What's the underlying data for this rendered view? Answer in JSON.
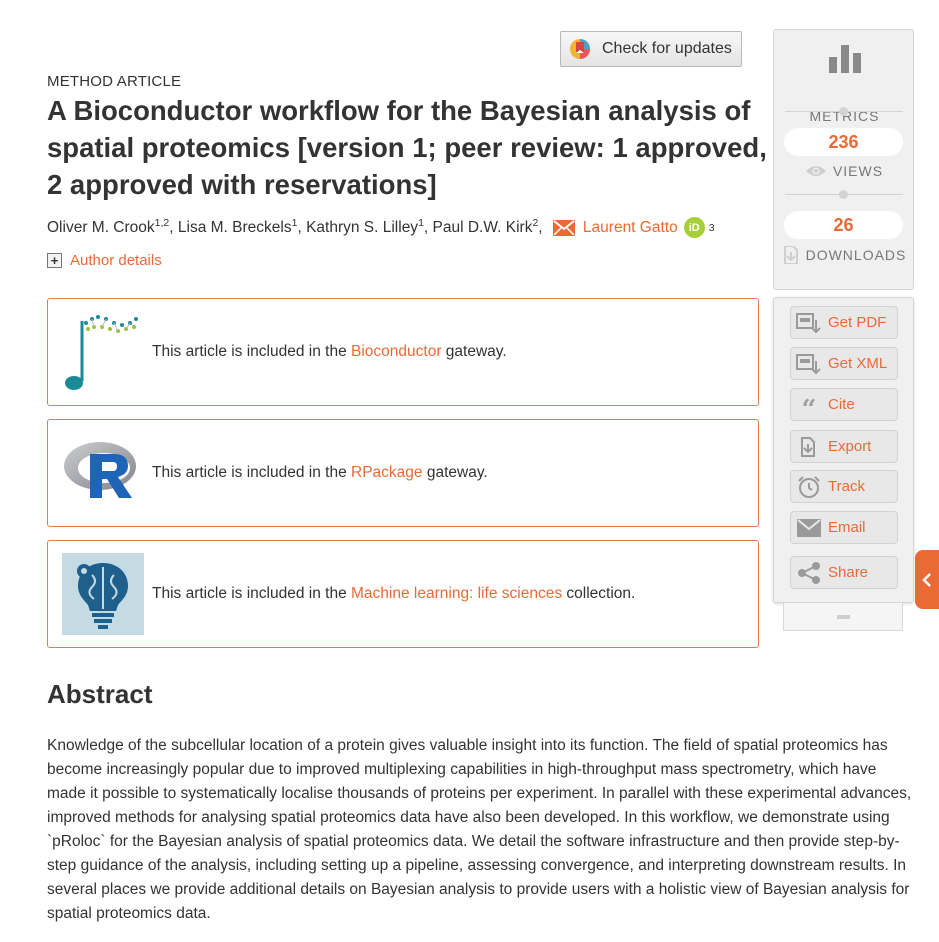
{
  "check_updates": {
    "label": "Check for updates"
  },
  "article": {
    "type": "METHOD ARTICLE",
    "title": "A Bioconductor workflow for the Bayesian analysis of spatial proteomics [version 1; peer review: 1 approved, 2 approved with reservations]",
    "authors": [
      {
        "name": "Oliver M. Crook",
        "aff": "1,2",
        "sep": ", "
      },
      {
        "name": "Lisa M. Breckels",
        "aff": "1",
        "sep": ", "
      },
      {
        "name": "Kathryn S. Lilley",
        "aff": "1",
        "sep": ", "
      },
      {
        "name": "Paul D.W. Kirk",
        "aff": "2",
        "sep": ", "
      }
    ],
    "corresponding_author": {
      "name": "Laurent Gatto",
      "aff": "3",
      "orcid_label": "iD"
    },
    "author_details_label": "Author details"
  },
  "gateways": [
    {
      "prefix": "This article is included in the ",
      "link": "Bioconductor",
      "suffix": " gateway.",
      "logo": "bioconductor-logo"
    },
    {
      "prefix": "This article is included in the ",
      "link": "RPackage",
      "suffix": " gateway.",
      "logo": "r-logo"
    },
    {
      "prefix": "This article is included in the ",
      "link": "Machine learning: life sciences",
      "suffix": " collection.",
      "logo": "ml-brain-logo"
    }
  ],
  "abstract": {
    "heading": "Abstract",
    "text": "Knowledge of the subcellular location of a protein gives valuable insight into its function. The field of spatial proteomics has become increasingly popular due to improved multiplexing capabilities in high-throughput mass spectrometry, which have made it possible to systematically localise thousands of proteins per experiment. In parallel with these experimental advances, improved methods for analysing spatial proteomics data have also been developed. In this workflow, we demonstrate using `pRoloc` for the Bayesian analysis of spatial proteomics data. We detail the software infrastructure and then provide step-by-step guidance of the analysis, including setting up a pipeline, assessing convergence, and interpreting downstream results. In several places we provide additional details on Bayesian analysis to provide users with a holistic view of Bayesian analysis for spatial proteomics data."
  },
  "metrics": {
    "label": "METRICS",
    "views_count": "236",
    "views_label": "VIEWS",
    "downloads_count": "26",
    "downloads_label": "DOWNLOADS"
  },
  "actions": {
    "get_pdf": "Get PDF",
    "get_xml": "Get XML",
    "cite": "Cite",
    "export": "Export",
    "track": "Track",
    "email": "Email",
    "share": "Share"
  },
  "colors": {
    "accent": "#ea6a35",
    "text": "#333333",
    "panel": "#f0f0f0"
  }
}
